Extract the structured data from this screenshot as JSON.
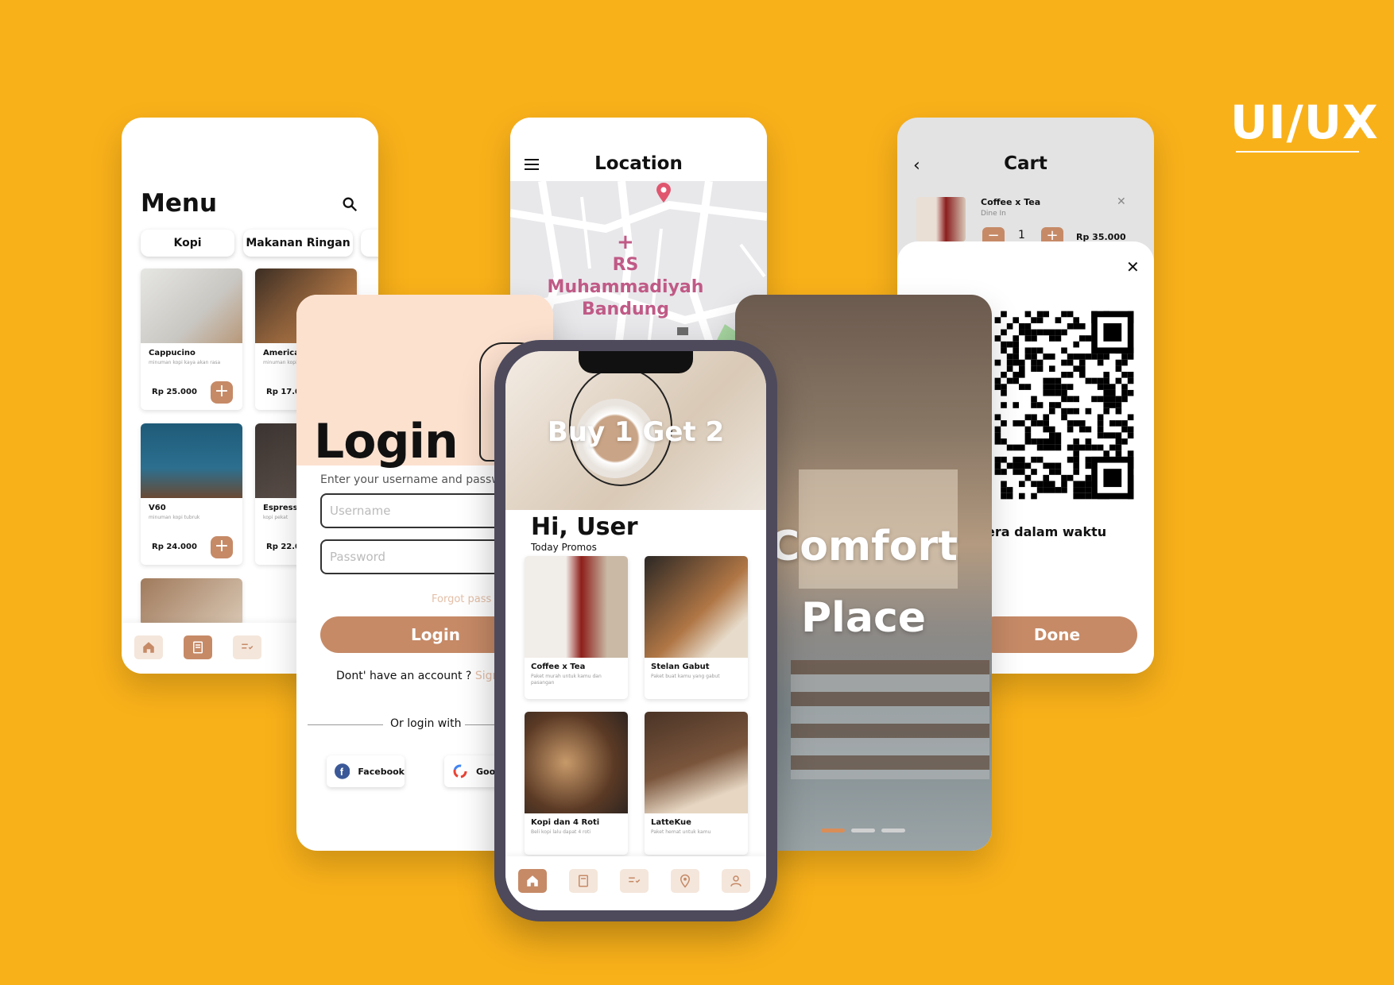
{
  "brand": {
    "label": "UI/UX"
  },
  "colors": {
    "background": "#F9B11A",
    "accent": "#C68A67",
    "accent_light": "#F4E6DB",
    "login_header": "#FCE1CF"
  },
  "menu": {
    "title": "Menu",
    "categories": [
      "Kopi",
      "Makanan Ringan"
    ],
    "products": [
      {
        "name": "Cappucino",
        "desc": "minuman kopi kaya akan rasa",
        "price": "Rp 25.000"
      },
      {
        "name": "America",
        "desc": "minuman kopi hitam",
        "price": "Rp 17.00"
      },
      {
        "name": "V60",
        "desc": "minuman kopi tubruk",
        "price": "Rp 24.000"
      },
      {
        "name": "Espresso",
        "desc": "kopi pekat",
        "price": "Rp 22.0"
      }
    ],
    "tabs": [
      "home-icon",
      "menu-book-icon",
      "checklist-icon"
    ]
  },
  "location": {
    "title": "Location",
    "place": "RS Muhammadiyah Bandung"
  },
  "cart": {
    "title": "Cart",
    "item": {
      "name": "Coffee x Tea",
      "sub": "Dine In",
      "qty": "1",
      "price": "Rp 35.000",
      "minus": "−",
      "plus": "+"
    },
    "message": "era dalam waktu",
    "done": "Done"
  },
  "login": {
    "title": "Login",
    "subtitle": "Enter your username and passw",
    "username_placeholder": "Username",
    "password_placeholder": "Password",
    "forgot": "Forgot pass",
    "button": "Login",
    "no_account": "Dont' have an account ?",
    "signup": "Sign",
    "or": "Or login with",
    "facebook": "Facebook",
    "google": "Goo"
  },
  "onboarding": {
    "title_line1": "Comfort",
    "title_line2": "Place"
  },
  "home": {
    "promo": "Buy 1 Get 2",
    "greeting": "Hi, User",
    "section": "Today Promos",
    "cards": [
      {
        "name": "Coffee x Tea",
        "desc": "Paket murah untuk kamu dan pasangan"
      },
      {
        "name": "Stelan Gabut",
        "desc": "Paket buat kamu yang gabut"
      },
      {
        "name": "Kopi dan 4 Roti",
        "desc": "Beli kopi lalu dapat 4 roti"
      },
      {
        "name": "LatteKue",
        "desc": "Paket hemat untuk kamu"
      }
    ]
  }
}
